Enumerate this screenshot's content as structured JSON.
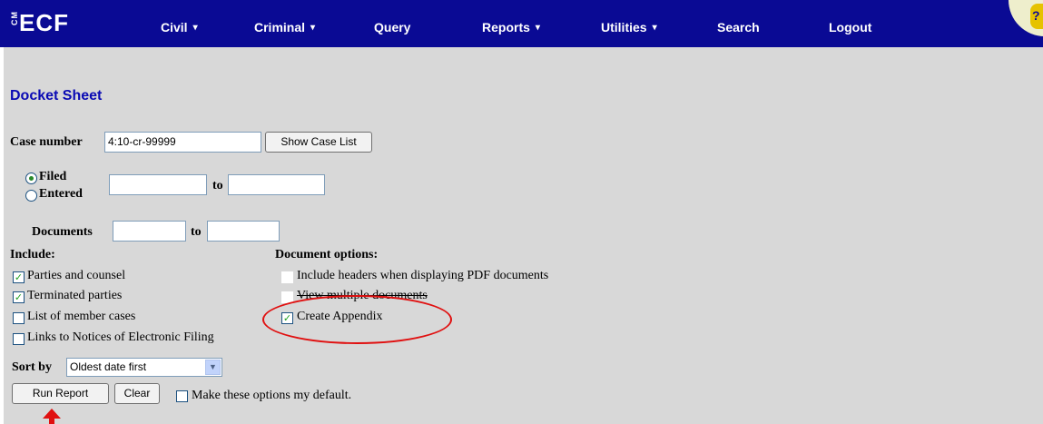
{
  "app": {
    "logo_text": "ECF",
    "logo_vertical": "CM"
  },
  "nav": {
    "items": [
      {
        "label": "Civil",
        "has_dropdown": true
      },
      {
        "label": "Criminal",
        "has_dropdown": true
      },
      {
        "label": "Query",
        "has_dropdown": false
      },
      {
        "label": "Reports",
        "has_dropdown": true
      },
      {
        "label": "Utilities",
        "has_dropdown": true
      },
      {
        "label": "Search",
        "has_dropdown": false
      },
      {
        "label": "Logout",
        "has_dropdown": false
      }
    ],
    "dropdown_caret": "▾",
    "help_glyph": "?"
  },
  "page": {
    "title": "Docket Sheet"
  },
  "form": {
    "case_number_label": "Case number",
    "case_number_value": "4:10-cr-99999",
    "show_case_list_label": "Show Case List",
    "date_filter": {
      "filed_label": "Filed",
      "entered_label": "Entered",
      "selected": "Filed",
      "from_value": "",
      "to_label": "to",
      "to_value": ""
    },
    "documents": {
      "label": "Documents",
      "from_value": "",
      "to_label": "to",
      "to_value": ""
    },
    "include": {
      "heading": "Include:",
      "options": [
        {
          "label": "Parties and counsel",
          "checked": true
        },
        {
          "label": "Terminated parties",
          "checked": true
        },
        {
          "label": "List of member cases",
          "checked": false
        },
        {
          "label": "Links to Notices of Electronic Filing",
          "checked": false
        }
      ]
    },
    "document_options": {
      "heading": "Document options:",
      "options": [
        {
          "label": "Include headers when displaying PDF documents",
          "checked": false
        },
        {
          "label": "View multiple documents",
          "checked": false
        },
        {
          "label": "Create Appendix",
          "checked": true
        }
      ]
    },
    "sort_by": {
      "label": "Sort by",
      "selected": "Oldest date first"
    },
    "run_report_label": "Run Report",
    "clear_label": "Clear",
    "default_label": "Make these options my default.",
    "default_checked": false
  },
  "colors": {
    "nav_background": "#0a0a94",
    "content_background": "#d8d8d8",
    "title_color": "#0a0ab4",
    "annotation_red": "#e01010",
    "check_green": "#21a121"
  },
  "icons": {
    "check_glyph": "✓",
    "select_arrow_glyph": "▼"
  }
}
